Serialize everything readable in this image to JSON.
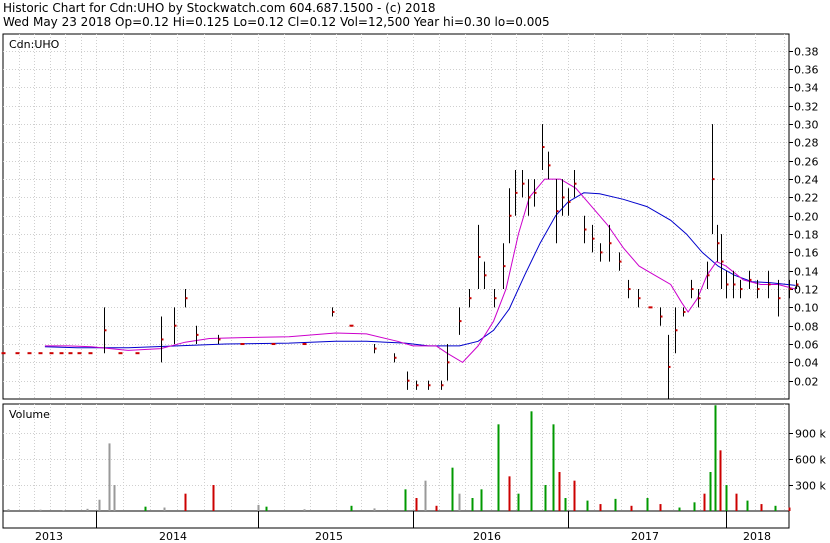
{
  "header": {
    "line1": "Historic Chart for Cdn:UHO by Stockwatch.com 604.687.1500 - (c) 2018",
    "line2": "Wed May 23 2018   Op=0.12   Hi=0.125   Lo=0.12   Cl=0.12   Vol=12,500   Year hi=0.30   lo=0.005"
  },
  "colors": {
    "price_up": "#000000",
    "price_down": "#cc0000",
    "ma_short": "#cc00cc",
    "ma_long": "#0000cc",
    "vol_up": "#009900",
    "vol_down": "#cc0000",
    "vol_flat": "#999999",
    "grid": "#cfcfcf"
  },
  "chart_data": [
    {
      "type": "line",
      "title": "Cdn:UHO",
      "ylim": [
        0,
        0.4
      ],
      "y_ticks": [
        "0.02",
        "0.04",
        "0.06",
        "0.08",
        "0.10",
        "0.12",
        "0.14",
        "0.16",
        "0.18",
        "0.20",
        "0.22",
        "0.24",
        "0.26",
        "0.28",
        "0.30",
        "0.32",
        "0.34",
        "0.36",
        "0.38"
      ],
      "x_labels": [
        "2013",
        "2014",
        "2015",
        "2016",
        "2017",
        "2018"
      ],
      "grid": true,
      "series": [
        {
          "kind": "price",
          "points": [
            {
              "t": 2013.0,
              "lo": 0.05,
              "hi": 0.05
            },
            {
              "t": 2013.15,
              "lo": 0.05,
              "hi": 0.05
            },
            {
              "t": 2013.28,
              "lo": 0.05,
              "hi": 0.05
            },
            {
              "t": 2013.4,
              "lo": 0.05,
              "hi": 0.05
            },
            {
              "t": 2013.52,
              "lo": 0.05,
              "hi": 0.05
            },
            {
              "t": 2013.62,
              "lo": 0.05,
              "hi": 0.05
            },
            {
              "t": 2013.72,
              "lo": 0.05,
              "hi": 0.05
            },
            {
              "t": 2013.82,
              "lo": 0.05,
              "hi": 0.05
            },
            {
              "t": 2013.94,
              "lo": 0.05,
              "hi": 0.05
            },
            {
              "t": 2014.05,
              "lo": 0.05,
              "hi": 0.1
            },
            {
              "t": 2014.15,
              "lo": 0.05,
              "hi": 0.05
            },
            {
              "t": 2014.25,
              "lo": 0.05,
              "hi": 0.05
            },
            {
              "t": 2014.4,
              "lo": 0.04,
              "hi": 0.09
            },
            {
              "t": 2014.48,
              "lo": 0.06,
              "hi": 0.1
            },
            {
              "t": 2014.55,
              "lo": 0.1,
              "hi": 0.12
            },
            {
              "t": 2014.62,
              "lo": 0.06,
              "hi": 0.08
            },
            {
              "t": 2014.75,
              "lo": 0.06,
              "hi": 0.07
            },
            {
              "t": 2014.9,
              "lo": 0.06,
              "hi": 0.06
            },
            {
              "t": 2015.1,
              "lo": 0.06,
              "hi": 0.06
            },
            {
              "t": 2015.3,
              "lo": 0.06,
              "hi": 0.06
            },
            {
              "t": 2015.48,
              "lo": 0.09,
              "hi": 0.1
            },
            {
              "t": 2015.6,
              "lo": 0.08,
              "hi": 0.08
            },
            {
              "t": 2015.75,
              "lo": 0.05,
              "hi": 0.06
            },
            {
              "t": 2015.88,
              "lo": 0.04,
              "hi": 0.05
            },
            {
              "t": 2015.96,
              "lo": 0.01,
              "hi": 0.03
            },
            {
              "t": 2016.02,
              "lo": 0.01,
              "hi": 0.02
            },
            {
              "t": 2016.1,
              "lo": 0.01,
              "hi": 0.02
            },
            {
              "t": 2016.18,
              "lo": 0.01,
              "hi": 0.02
            },
            {
              "t": 2016.22,
              "lo": 0.02,
              "hi": 0.06
            },
            {
              "t": 2016.3,
              "lo": 0.07,
              "hi": 0.1
            },
            {
              "t": 2016.36,
              "lo": 0.1,
              "hi": 0.12
            },
            {
              "t": 2016.42,
              "lo": 0.12,
              "hi": 0.19
            },
            {
              "t": 2016.46,
              "lo": 0.12,
              "hi": 0.15
            },
            {
              "t": 2016.52,
              "lo": 0.1,
              "hi": 0.12
            },
            {
              "t": 2016.58,
              "lo": 0.12,
              "hi": 0.17
            },
            {
              "t": 2016.62,
              "lo": 0.17,
              "hi": 0.23
            },
            {
              "t": 2016.66,
              "lo": 0.2,
              "hi": 0.25
            },
            {
              "t": 2016.7,
              "lo": 0.22,
              "hi": 0.25
            },
            {
              "t": 2016.74,
              "lo": 0.2,
              "hi": 0.24
            },
            {
              "t": 2016.78,
              "lo": 0.21,
              "hi": 0.24
            },
            {
              "t": 2016.83,
              "lo": 0.25,
              "hi": 0.3
            },
            {
              "t": 2016.87,
              "lo": 0.24,
              "hi": 0.27
            },
            {
              "t": 2016.92,
              "lo": 0.17,
              "hi": 0.24
            },
            {
              "t": 2016.96,
              "lo": 0.2,
              "hi": 0.24
            },
            {
              "t": 2017.0,
              "lo": 0.2,
              "hi": 0.23
            },
            {
              "t": 2017.04,
              "lo": 0.22,
              "hi": 0.25
            },
            {
              "t": 2017.1,
              "lo": 0.17,
              "hi": 0.2
            },
            {
              "t": 2017.15,
              "lo": 0.16,
              "hi": 0.19
            },
            {
              "t": 2017.2,
              "lo": 0.15,
              "hi": 0.17
            },
            {
              "t": 2017.26,
              "lo": 0.15,
              "hi": 0.19
            },
            {
              "t": 2017.32,
              "lo": 0.14,
              "hi": 0.16
            },
            {
              "t": 2017.38,
              "lo": 0.11,
              "hi": 0.13
            },
            {
              "t": 2017.44,
              "lo": 0.1,
              "hi": 0.12
            },
            {
              "t": 2017.52,
              "lo": 0.1,
              "hi": 0.1
            },
            {
              "t": 2017.58,
              "lo": 0.08,
              "hi": 0.1
            },
            {
              "t": 2017.63,
              "lo": 0.0,
              "hi": 0.07
            },
            {
              "t": 2017.68,
              "lo": 0.05,
              "hi": 0.1
            },
            {
              "t": 2017.73,
              "lo": 0.09,
              "hi": 0.1
            },
            {
              "t": 2017.78,
              "lo": 0.11,
              "hi": 0.13
            },
            {
              "t": 2017.82,
              "lo": 0.1,
              "hi": 0.12
            },
            {
              "t": 2017.88,
              "lo": 0.12,
              "hi": 0.15
            },
            {
              "t": 2017.91,
              "lo": 0.18,
              "hi": 0.3
            },
            {
              "t": 2017.94,
              "lo": 0.15,
              "hi": 0.19
            },
            {
              "t": 2017.97,
              "lo": 0.12,
              "hi": 0.18
            },
            {
              "t": 2018.0,
              "lo": 0.11,
              "hi": 0.14
            },
            {
              "t": 2018.04,
              "lo": 0.11,
              "hi": 0.14
            },
            {
              "t": 2018.08,
              "lo": 0.11,
              "hi": 0.13
            },
            {
              "t": 2018.13,
              "lo": 0.12,
              "hi": 0.14
            },
            {
              "t": 2018.18,
              "lo": 0.11,
              "hi": 0.13
            },
            {
              "t": 2018.24,
              "lo": 0.11,
              "hi": 0.14
            },
            {
              "t": 2018.3,
              "lo": 0.09,
              "hi": 0.13
            },
            {
              "t": 2018.36,
              "lo": 0.11,
              "hi": 0.13
            },
            {
              "t": 2018.4,
              "lo": 0.12,
              "hi": 0.13
            }
          ]
        },
        {
          "kind": "ma_short",
          "points": [
            [
              2013.45,
              0.058
            ],
            [
              2013.7,
              0.058
            ],
            [
              2013.95,
              0.057
            ],
            [
              2014.2,
              0.053
            ],
            [
              2014.4,
              0.055
            ],
            [
              2014.55,
              0.062
            ],
            [
              2014.7,
              0.066
            ],
            [
              2014.9,
              0.067
            ],
            [
              2015.2,
              0.068
            ],
            [
              2015.5,
              0.072
            ],
            [
              2015.7,
              0.071
            ],
            [
              2015.9,
              0.063
            ],
            [
              2016.0,
              0.058
            ],
            [
              2016.15,
              0.058
            ],
            [
              2016.22,
              0.05
            ],
            [
              2016.32,
              0.04
            ],
            [
              2016.42,
              0.058
            ],
            [
              2016.52,
              0.085
            ],
            [
              2016.6,
              0.12
            ],
            [
              2016.68,
              0.18
            ],
            [
              2016.75,
              0.22
            ],
            [
              2016.85,
              0.24
            ],
            [
              2016.95,
              0.24
            ],
            [
              2017.05,
              0.23
            ],
            [
              2017.15,
              0.21
            ],
            [
              2017.25,
              0.19
            ],
            [
              2017.35,
              0.165
            ],
            [
              2017.45,
              0.145
            ],
            [
              2017.55,
              0.135
            ],
            [
              2017.65,
              0.125
            ],
            [
              2017.72,
              0.105
            ],
            [
              2017.76,
              0.095
            ],
            [
              2017.82,
              0.11
            ],
            [
              2017.88,
              0.135
            ],
            [
              2017.94,
              0.15
            ],
            [
              2018.0,
              0.145
            ],
            [
              2018.1,
              0.13
            ],
            [
              2018.2,
              0.125
            ],
            [
              2018.3,
              0.125
            ],
            [
              2018.4,
              0.12
            ]
          ]
        },
        {
          "kind": "ma_long",
          "points": [
            [
              2013.45,
              0.057
            ],
            [
              2013.8,
              0.056
            ],
            [
              2014.2,
              0.056
            ],
            [
              2014.5,
              0.058
            ],
            [
              2014.8,
              0.06
            ],
            [
              2015.2,
              0.061
            ],
            [
              2015.5,
              0.063
            ],
            [
              2015.7,
              0.063
            ],
            [
              2015.95,
              0.061
            ],
            [
              2016.1,
              0.058
            ],
            [
              2016.3,
              0.058
            ],
            [
              2016.42,
              0.063
            ],
            [
              2016.52,
              0.075
            ],
            [
              2016.62,
              0.098
            ],
            [
              2016.72,
              0.135
            ],
            [
              2016.82,
              0.17
            ],
            [
              2016.92,
              0.2
            ],
            [
              2017.0,
              0.215
            ],
            [
              2017.1,
              0.225
            ],
            [
              2017.2,
              0.224
            ],
            [
              2017.35,
              0.218
            ],
            [
              2017.5,
              0.21
            ],
            [
              2017.65,
              0.195
            ],
            [
              2017.75,
              0.18
            ],
            [
              2017.85,
              0.16
            ],
            [
              2017.95,
              0.145
            ],
            [
              2018.05,
              0.135
            ],
            [
              2018.15,
              0.128
            ],
            [
              2018.25,
              0.127
            ],
            [
              2018.4,
              0.124
            ]
          ]
        }
      ]
    },
    {
      "type": "bar",
      "title": "Volume",
      "y_ticks": [
        "300 k",
        "600 k",
        "900 k"
      ],
      "ylim": [
        0,
        1200000
      ],
      "values": [
        {
          "t": 2013.05,
          "v": 20000,
          "d": "flat"
        },
        {
          "t": 2013.4,
          "v": 15000,
          "d": "flat"
        },
        {
          "t": 2013.65,
          "v": 10000,
          "d": "flat"
        },
        {
          "t": 2013.9,
          "v": 25000,
          "d": "flat"
        },
        {
          "t": 2014.02,
          "v": 130000,
          "d": "flat"
        },
        {
          "t": 2014.08,
          "v": 780000,
          "d": "flat"
        },
        {
          "t": 2014.11,
          "v": 300000,
          "d": "flat"
        },
        {
          "t": 2014.3,
          "v": 50000,
          "d": "up"
        },
        {
          "t": 2014.42,
          "v": 40000,
          "d": "flat"
        },
        {
          "t": 2014.55,
          "v": 200000,
          "d": "down"
        },
        {
          "t": 2014.72,
          "v": 300000,
          "d": "down"
        },
        {
          "t": 2015.0,
          "v": 70000,
          "d": "flat"
        },
        {
          "t": 2015.05,
          "v": 50000,
          "d": "up"
        },
        {
          "t": 2015.3,
          "v": 20000,
          "d": "flat"
        },
        {
          "t": 2015.6,
          "v": 60000,
          "d": "up"
        },
        {
          "t": 2015.75,
          "v": 30000,
          "d": "flat"
        },
        {
          "t": 2015.95,
          "v": 250000,
          "d": "up"
        },
        {
          "t": 2016.02,
          "v": 150000,
          "d": "down"
        },
        {
          "t": 2016.08,
          "v": 350000,
          "d": "flat"
        },
        {
          "t": 2016.15,
          "v": 60000,
          "d": "down"
        },
        {
          "t": 2016.25,
          "v": 500000,
          "d": "up"
        },
        {
          "t": 2016.3,
          "v": 200000,
          "d": "flat"
        },
        {
          "t": 2016.38,
          "v": 150000,
          "d": "up"
        },
        {
          "t": 2016.44,
          "v": 250000,
          "d": "up"
        },
        {
          "t": 2016.55,
          "v": 1000000,
          "d": "up"
        },
        {
          "t": 2016.62,
          "v": 400000,
          "d": "down"
        },
        {
          "t": 2016.68,
          "v": 200000,
          "d": "up"
        },
        {
          "t": 2016.76,
          "v": 1150000,
          "d": "up"
        },
        {
          "t": 2016.85,
          "v": 300000,
          "d": "up"
        },
        {
          "t": 2016.9,
          "v": 1000000,
          "d": "up"
        },
        {
          "t": 2016.94,
          "v": 450000,
          "d": "down"
        },
        {
          "t": 2016.98,
          "v": 150000,
          "d": "up"
        },
        {
          "t": 2017.04,
          "v": 350000,
          "d": "down"
        },
        {
          "t": 2017.12,
          "v": 120000,
          "d": "up"
        },
        {
          "t": 2017.2,
          "v": 80000,
          "d": "down"
        },
        {
          "t": 2017.3,
          "v": 140000,
          "d": "up"
        },
        {
          "t": 2017.4,
          "v": 60000,
          "d": "down"
        },
        {
          "t": 2017.5,
          "v": 150000,
          "d": "up"
        },
        {
          "t": 2017.58,
          "v": 80000,
          "d": "down"
        },
        {
          "t": 2017.7,
          "v": 40000,
          "d": "up"
        },
        {
          "t": 2017.8,
          "v": 100000,
          "d": "up"
        },
        {
          "t": 2017.86,
          "v": 200000,
          "d": "down"
        },
        {
          "t": 2017.9,
          "v": 450000,
          "d": "up"
        },
        {
          "t": 2017.93,
          "v": 1220000,
          "d": "up"
        },
        {
          "t": 2017.96,
          "v": 700000,
          "d": "down"
        },
        {
          "t": 2018.0,
          "v": 300000,
          "d": "up"
        },
        {
          "t": 2018.06,
          "v": 200000,
          "d": "down"
        },
        {
          "t": 2018.12,
          "v": 120000,
          "d": "up"
        },
        {
          "t": 2018.2,
          "v": 80000,
          "d": "down"
        },
        {
          "t": 2018.28,
          "v": 60000,
          "d": "up"
        },
        {
          "t": 2018.36,
          "v": 40000,
          "d": "down"
        }
      ]
    }
  ]
}
